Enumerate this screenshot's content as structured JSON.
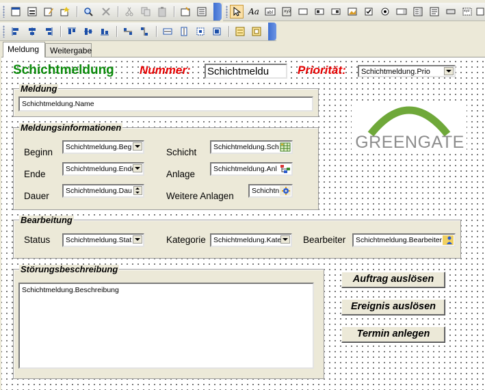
{
  "toolbar1": {
    "icons": [
      "form-icon",
      "view-icon",
      "edit-icon",
      "wizard-icon",
      "find-icon",
      "delete-icon",
      "cut-icon",
      "copy-icon",
      "paste-icon",
      "properties-icon",
      "field-list-icon",
      "pointer-icon",
      "label-icon",
      "textbox-icon",
      "option-group-icon",
      "toggle-icon",
      "option-button-icon",
      "frame-icon",
      "checkbox-icon",
      "radio-icon",
      "combo-icon",
      "list-icon",
      "memo-icon",
      "button-icon",
      "image-icon",
      "more-icon"
    ]
  },
  "toolbar2": {
    "icons": [
      "align-left-icon",
      "align-center-icon",
      "align-right-icon",
      "align-top-icon",
      "align-middle-icon",
      "align-bottom-icon",
      "space-horizontal-icon",
      "space-vertical-icon",
      "size-width-icon",
      "size-height-icon",
      "size-both-icon",
      "bring-front-icon",
      "tab-order-icon"
    ]
  },
  "tabs": [
    "Meldung",
    "Weitergabe"
  ],
  "header": {
    "title": "Schichtmeldung",
    "nummer_label": "Nummer:",
    "nummer_value": "Schichtmeldu",
    "prioritaet_label": "Priorität:",
    "prioritaet_value": "Schichtmeldung.Prio"
  },
  "meldung": {
    "group_title": "Meldung",
    "name_field": "Schichtmeldung.Name"
  },
  "logo": {
    "text": "GREENGATE",
    "color": "#5e9e32"
  },
  "info": {
    "group_title": "Meldungsinformationen",
    "beginn_label": "Beginn",
    "beginn_value": "Schichtmeldung.Beg",
    "ende_label": "Ende",
    "ende_value": "Schichtmeldung.Ende",
    "dauer_label": "Dauer",
    "dauer_value": "Schichtmeldung.Dau",
    "schicht_label": "Schicht",
    "schicht_value": "Schichtmeldung.Sch",
    "anlage_label": "Anlage",
    "anlage_value": "Schichtmeldung.Anl",
    "weitere_label": "Weitere Anlagen",
    "weitere_value": "Schichtn"
  },
  "bearbeitung": {
    "group_title": "Bearbeitung",
    "status_label": "Status",
    "status_value": "Schichtmeldung.Stat",
    "kategorie_label": "Kategorie",
    "kategorie_value": "Schichtmeldung.Kate",
    "bearbeiter_label": "Bearbeiter",
    "bearbeiter_value": "Schichtmeldung.Bearbeiter"
  },
  "stoerung": {
    "group_title": "Störungsbeschreibung",
    "beschreibung_value": "Schichtmeldung.Beschreibung"
  },
  "buttons": {
    "auftrag": "Auftrag auslösen",
    "ereignis": "Ereignis auslösen",
    "termin": "Termin anlegen"
  }
}
